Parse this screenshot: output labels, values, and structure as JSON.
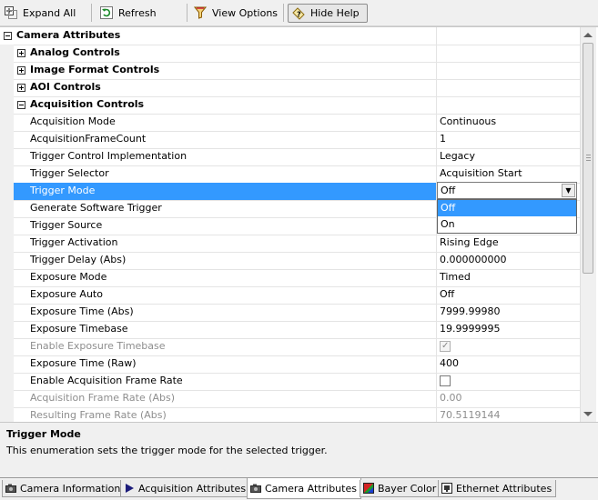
{
  "toolbar": {
    "expand_all": "Expand All",
    "refresh": "Refresh",
    "view_options": "View Options",
    "hide_help": "Hide Help"
  },
  "tree": {
    "root": "Camera Attributes",
    "categories": {
      "analog": "Analog Controls",
      "image_format": "Image Format Controls",
      "aoi": "AOI Controls",
      "acquisition": "Acquisition Controls"
    },
    "rows": [
      {
        "name": "Acquisition Mode",
        "value": "Continuous"
      },
      {
        "name": "AcquisitionFrameCount",
        "value": "1"
      },
      {
        "name": "Trigger Control Implementation",
        "value": "Legacy"
      },
      {
        "name": "Trigger Selector",
        "value": "Acquisition Start"
      },
      {
        "name": "Trigger Mode",
        "value": "Off"
      },
      {
        "name": "Generate Software Trigger",
        "value": ""
      },
      {
        "name": "Trigger Source",
        "value": ""
      },
      {
        "name": "Trigger Activation",
        "value": "Rising Edge"
      },
      {
        "name": "Trigger Delay (Abs)",
        "value": "0.000000000"
      },
      {
        "name": "Exposure Mode",
        "value": "Timed"
      },
      {
        "name": "Exposure Auto",
        "value": "Off"
      },
      {
        "name": "Exposure Time (Abs)",
        "value": "7999.99980"
      },
      {
        "name": "Exposure Timebase",
        "value": "19.9999995"
      },
      {
        "name": "Enable Exposure Timebase",
        "value": ""
      },
      {
        "name": "Exposure Time (Raw)",
        "value": "400"
      },
      {
        "name": "Enable Acquisition Frame Rate",
        "value": ""
      },
      {
        "name": "Acquisition Frame Rate (Abs)",
        "value": "0.00"
      },
      {
        "name": "Resulting Frame Rate (Abs)",
        "value": "70.5119144"
      }
    ]
  },
  "dropdown": {
    "current": "Off",
    "options": [
      "Off",
      "On"
    ],
    "arrow": "▼"
  },
  "help": {
    "title": "Trigger Mode",
    "description": "This enumeration sets the trigger mode for the selected trigger."
  },
  "tabs": [
    "Camera Information",
    "Acquisition Attributes",
    "Camera Attributes",
    "Bayer Color",
    "Ethernet Attributes"
  ],
  "checkbox_states": {
    "enable_exposure_timebase": "checked-disabled",
    "enable_acquisition_frame_rate": "unchecked"
  },
  "colors": {
    "selection": "#3399ff",
    "disabled_text": "#8e8e8e"
  }
}
